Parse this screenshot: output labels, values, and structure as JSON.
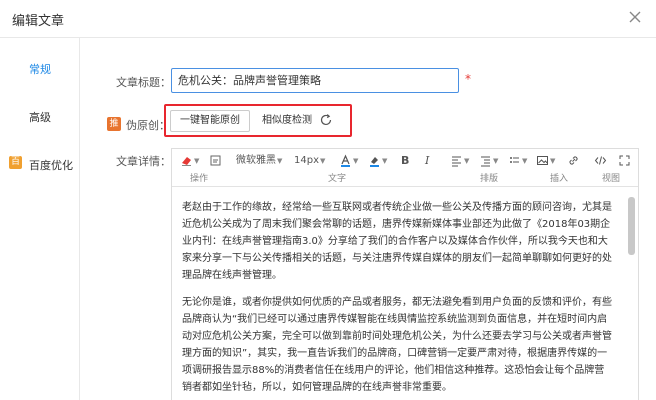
{
  "dialog": {
    "title": "编辑文章"
  },
  "nav": {
    "items": [
      {
        "label": "常规",
        "active": true
      },
      {
        "label": "高级",
        "active": false
      },
      {
        "label": "百度优化",
        "active": false
      }
    ],
    "baidu_icon_text": "百"
  },
  "form": {
    "title_label": "文章标题：",
    "title_value": "危机公关：品牌声誉管理策略",
    "required_mark": "*",
    "pseudo_icon_text": "推",
    "pseudo_label": "伪原创：",
    "oneclick_button": "一键智能原创",
    "similarity_button": "相似度检测",
    "detail_label": "文章详情："
  },
  "toolbar": {
    "font_family": "微软雅黑",
    "font_size": "14px",
    "groups": [
      "操作",
      "文字",
      "排版",
      "插入",
      "视图"
    ]
  },
  "content": {
    "paragraphs": [
      "老赵由于工作的缘故，经常给一些互联网或者传统企业做一些公关及传播方面的顾问咨询，尤其是近危机公关成为了周末我们聚会常聊的话题，唐界传媒新媒体事业部还为此做了《2018年03期企业内刊：在线声誉管理指南3.0》分享给了我们的合作客户以及媒体合作伙伴，所以我今天也和大家来分享一下与公关传播相关的话题，与关注唐界传媒自媒体的朋友们一起简单聊聊如何更好的处理品牌在线声誉管理。",
      "无论你是谁，或者你提供如何优质的产品或者服务，都无法避免看到用户负面的反馈和评价，有些品牌商认为“我们已经可以通过唐界传媒智能在线舆情监控系统监测到负面信息，并在短时间内启动对应危机公关方案，完全可以做到靠前时间处理危机公关，为什么还要去学习与公关或者声誉管理方面的知识”，其实，我一直告诉我们的品牌商，口碑营销一定要严肃对待，根据唐界传媒的一项调研报告显示88%的消费者信任在线用户的评论，他们相信这种推荐。这恐怕会让每个品牌营销者都如坐针毡，所以，如何管理品牌的在线声誉非常重要。"
    ]
  },
  "colors": {
    "accent": "#1e88e5",
    "highlight": "#e8262e",
    "required": "#e53935"
  }
}
